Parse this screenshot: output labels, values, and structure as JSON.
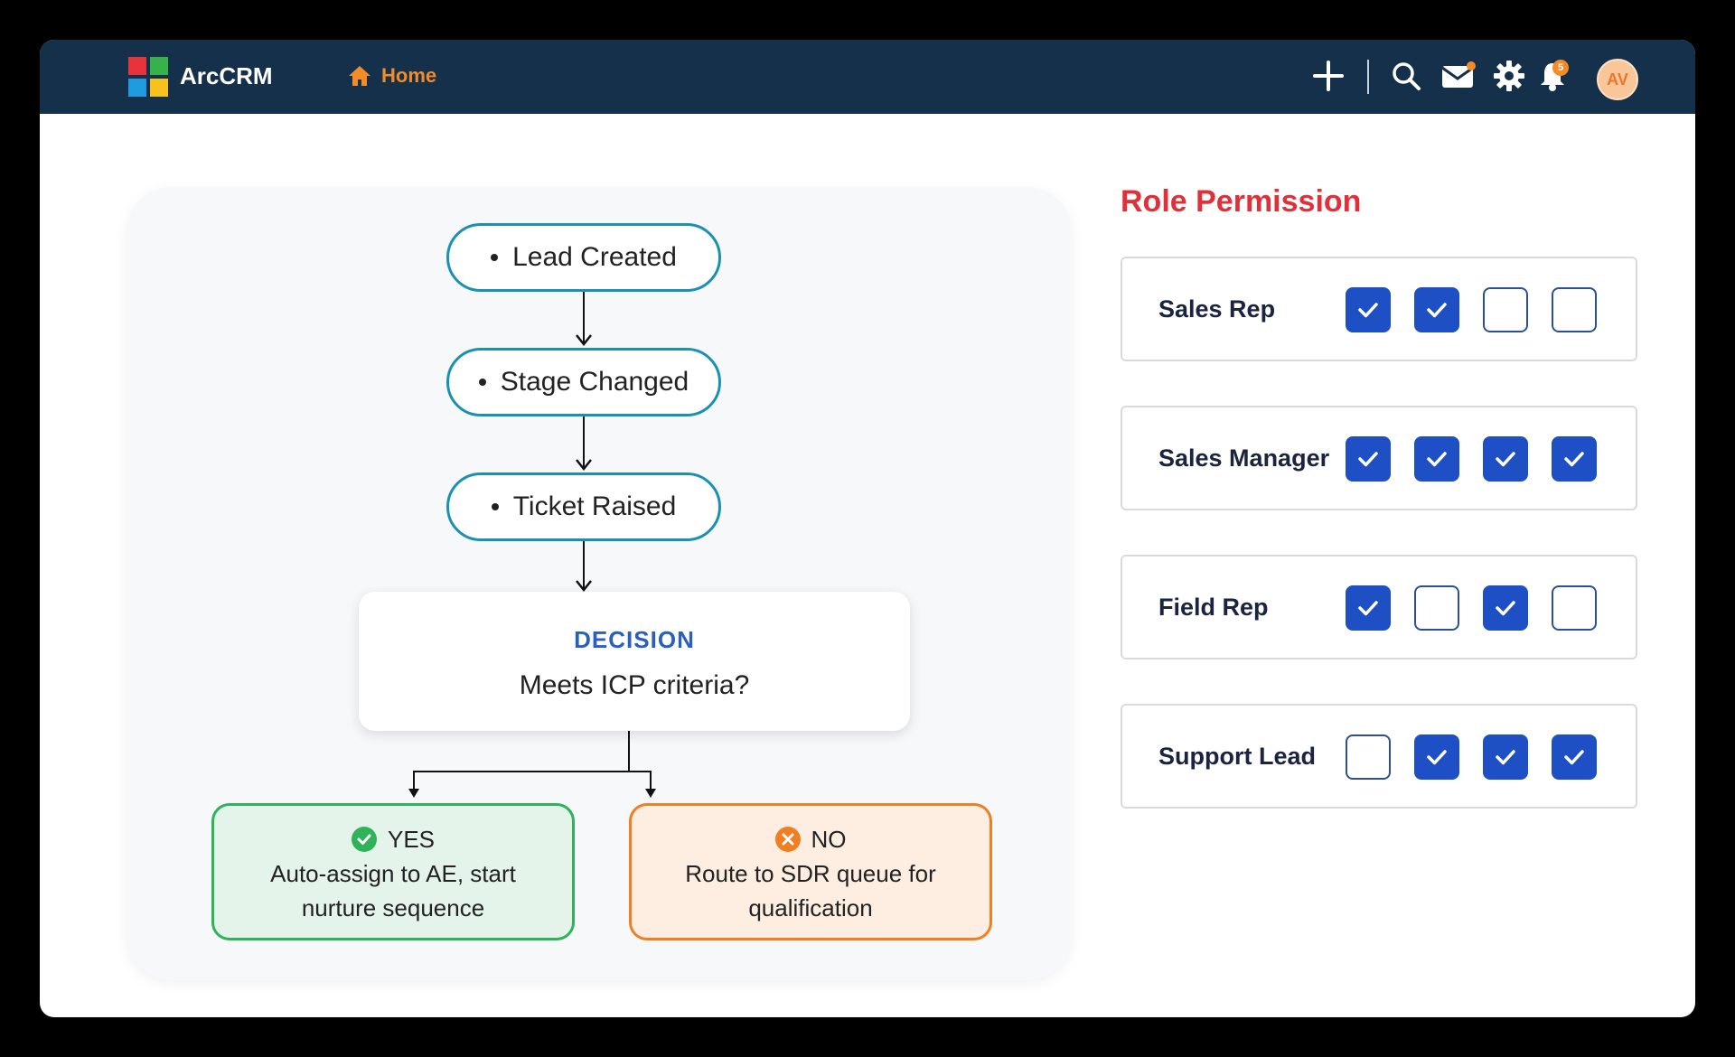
{
  "app": {
    "brand": "ArcCRM",
    "home_label": "Home",
    "notification_count": "5",
    "avatar_initials": "AV",
    "colors": {
      "topbar": "#14304a",
      "accent": "#f28c28",
      "checkbox": "#1e4fc4"
    }
  },
  "toolbar": {
    "icons": [
      "plus-icon",
      "search-icon",
      "mail-icon",
      "gear-icon",
      "bell-icon"
    ]
  },
  "flow": {
    "steps": [
      "Lead Created",
      "Stage Changed",
      "Ticket Raised"
    ],
    "decision_label": "DECISION",
    "decision_question": "Meets ICP criteria?",
    "yes": {
      "label": "YES",
      "text_line1": "Auto-assign to AE, start",
      "text_line2": "nurture sequence"
    },
    "no": {
      "label": "NO",
      "text_line1": "Route to SDR queue for",
      "text_line2": "qualification"
    }
  },
  "permissions": {
    "title": "Role Permission",
    "roles": [
      {
        "name": "Sales Rep",
        "checks": [
          true,
          true,
          false,
          false
        ]
      },
      {
        "name": "Sales Manager",
        "checks": [
          true,
          true,
          true,
          true
        ]
      },
      {
        "name": "Field Rep",
        "checks": [
          true,
          false,
          true,
          false
        ]
      },
      {
        "name": "Support Lead",
        "checks": [
          false,
          true,
          true,
          true
        ]
      }
    ]
  }
}
